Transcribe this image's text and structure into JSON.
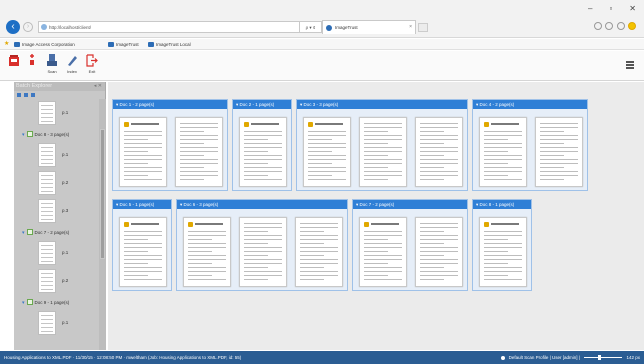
{
  "browser": {
    "address": "http://localhost/client/",
    "address_actions": "ρ ▾ ¢",
    "tab_title": "ImageTrust",
    "tab_close": "×",
    "window_controls": [
      "–",
      "▫",
      "✕"
    ],
    "favorites": [
      "Image Access Corporation",
      "ImageTrust",
      "ImageTrust Local"
    ]
  },
  "toolbar": {
    "buttons": [
      {
        "label": "",
        "icon": "inbox-icon"
      },
      {
        "label": "",
        "icon": "delete-icon"
      },
      {
        "label": "Scan",
        "icon": "scanner-icon"
      },
      {
        "label": "Index",
        "icon": "pencil-icon"
      },
      {
        "label": "Exit",
        "icon": "exit-icon"
      }
    ]
  },
  "explorer": {
    "title": "Batch Explorer",
    "pin": "◂ ✕",
    "tree": [
      {
        "type": "page",
        "label": "p.1"
      },
      {
        "type": "doc",
        "label": "Doc 8 - 3 page(s)"
      },
      {
        "type": "page",
        "label": "p.1"
      },
      {
        "type": "page",
        "label": "p.2"
      },
      {
        "type": "page",
        "label": "p.3"
      },
      {
        "type": "doc",
        "label": "Doc 7 - 2 page(s)"
      },
      {
        "type": "page",
        "label": "p.1"
      },
      {
        "type": "page",
        "label": "p.2"
      },
      {
        "type": "doc",
        "label": "Doc 9 - 1 page(s)"
      },
      {
        "type": "page",
        "label": "p.1"
      }
    ]
  },
  "documents": [
    {
      "label": "Doc 1 - 2 page(s)",
      "pages": 2
    },
    {
      "label": "Doc 2 - 1 page(s)",
      "pages": 1
    },
    {
      "label": "Doc 3 - 3 page(s)",
      "pages": 3
    },
    {
      "label": "Doc 4 - 2 page(s)",
      "pages": 2
    },
    {
      "label": "Doc 5 - 1 page(s)",
      "pages": 1
    },
    {
      "label": "Doc 6 - 3 page(s)",
      "pages": 3
    },
    {
      "label": "Doc 7 - 2 page(s)",
      "pages": 2
    },
    {
      "label": "Doc 8 - 1 page(s)",
      "pages": 1
    }
  ],
  "status": {
    "left": "Housing Applications to XML.PDF · 11/30/15 · 12:08:50 PM · mweltham (Job: Housing Applications to XML.PDF, id: 55)",
    "profile": "Default Scan Profile | User [admin] |",
    "zoom": "142 px"
  },
  "colors": {
    "accent": "#2f7fd6",
    "status_bar": "#2b5d93",
    "explorer_bg": "#c8c8c8",
    "delete_red": "#d9302c"
  }
}
